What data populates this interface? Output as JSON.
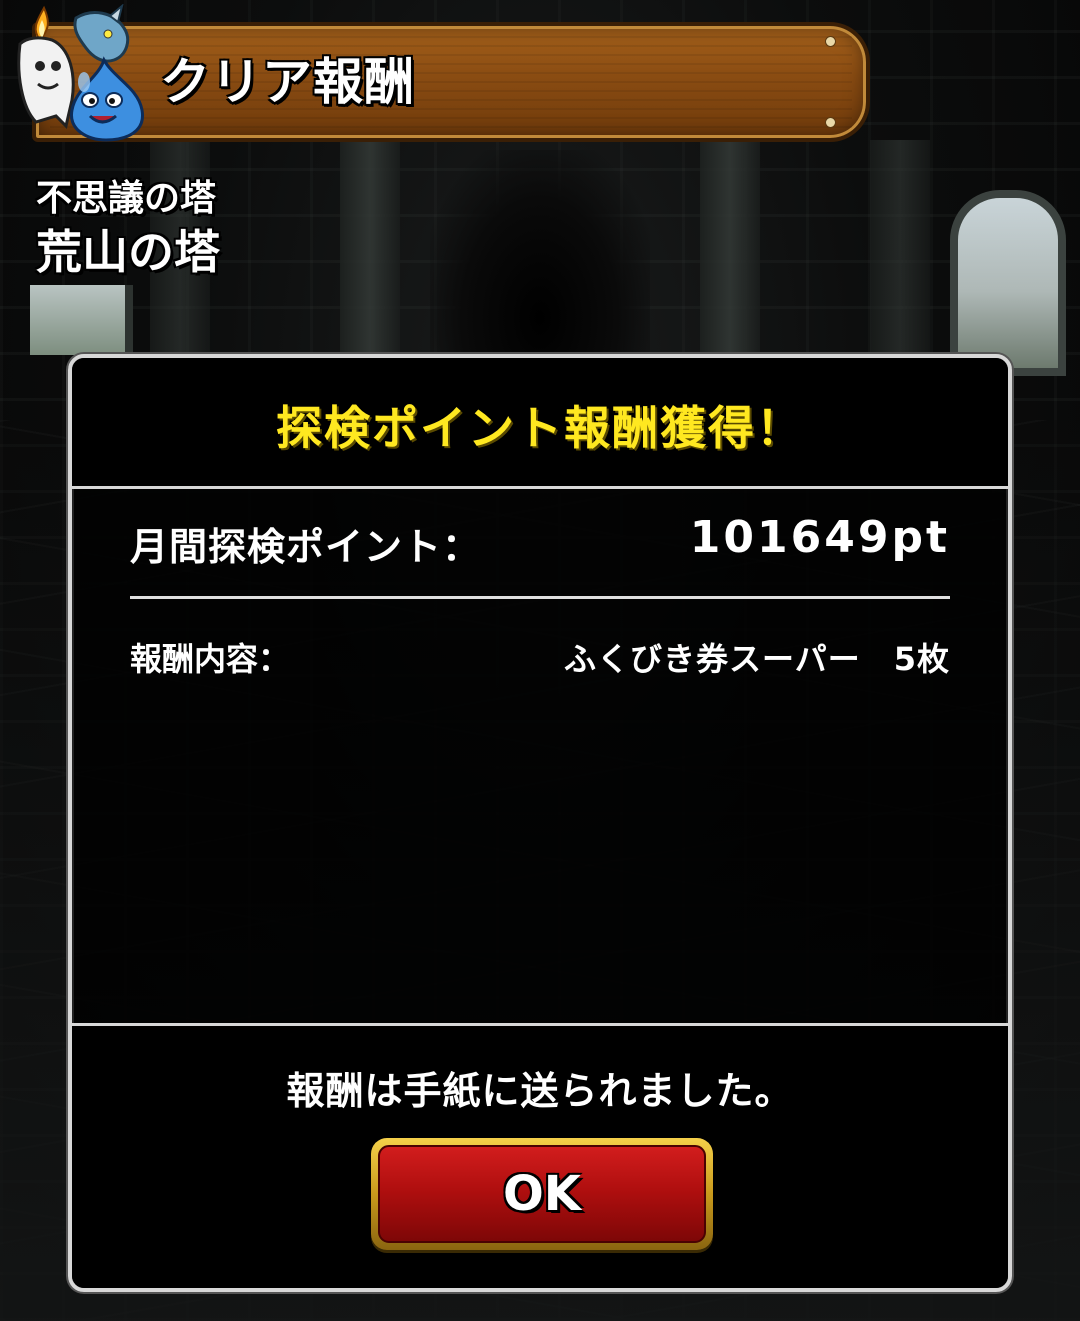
{
  "header": {
    "title": "クリア報酬"
  },
  "location": {
    "series": "不思議の塔",
    "name": "荒山の塔"
  },
  "dialog": {
    "title": "探検ポイント報酬獲得！",
    "points_label": "月間探検ポイント：",
    "points_value": "101649pt",
    "reward_label": "報酬内容：",
    "reward_value": "ふくびき券スーパー　5枚",
    "footer_message": "報酬は手紙に送られました。",
    "ok_label": "OK"
  },
  "colors": {
    "title_yellow": "#ffe820",
    "button_red": "#c01414",
    "button_gold": "#e0b43a",
    "banner_wood": "#8a4c12"
  },
  "icons": [
    "character-mascot-icon",
    "slime-icon"
  ]
}
